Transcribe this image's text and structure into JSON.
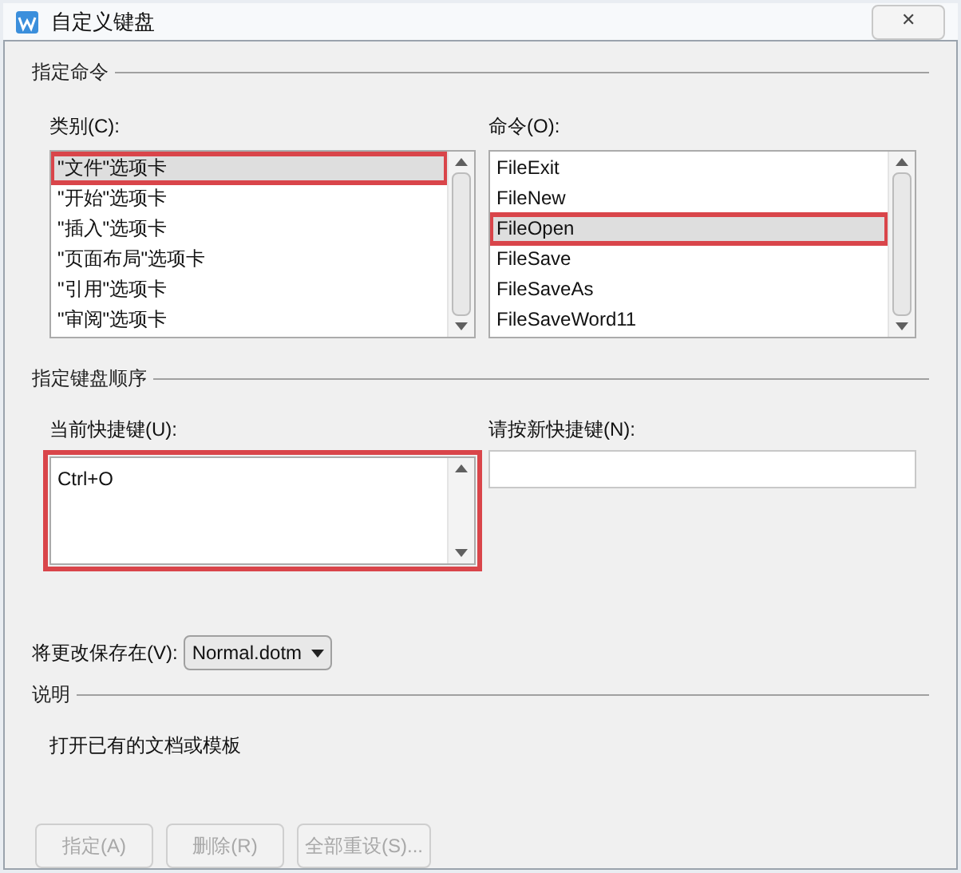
{
  "window": {
    "title": "自定义键盘",
    "close_label": "✕"
  },
  "command_group": {
    "title": "指定命令",
    "category": {
      "label": "类别(C):",
      "items": [
        {
          "text": "\"文件\"选项卡",
          "selected": true,
          "highlighted": true
        },
        {
          "text": "\"开始\"选项卡",
          "selected": false,
          "highlighted": false
        },
        {
          "text": "\"插入\"选项卡",
          "selected": false,
          "highlighted": false
        },
        {
          "text": "\"页面布局\"选项卡",
          "selected": false,
          "highlighted": false
        },
        {
          "text": "\"引用\"选项卡",
          "selected": false,
          "highlighted": false
        },
        {
          "text": "\"审阅\"选项卡",
          "selected": false,
          "highlighted": false
        }
      ]
    },
    "commands": {
      "label": "命令(O):",
      "items": [
        {
          "text": "FileExit",
          "selected": false,
          "highlighted": false
        },
        {
          "text": "FileNew",
          "selected": false,
          "highlighted": false
        },
        {
          "text": "FileOpen",
          "selected": true,
          "highlighted": true
        },
        {
          "text": "FileSave",
          "selected": false,
          "highlighted": false
        },
        {
          "text": "FileSaveAs",
          "selected": false,
          "highlighted": false
        },
        {
          "text": "FileSaveWord11",
          "selected": false,
          "highlighted": false
        }
      ]
    }
  },
  "keyboard_group": {
    "title": "指定键盘顺序",
    "current_keys": {
      "label": "当前快捷键(U):",
      "items": [
        "Ctrl+O"
      ],
      "highlighted": true
    },
    "new_key": {
      "label": "请按新快捷键(N):"
    }
  },
  "save_in": {
    "label": "将更改保存在(V):",
    "value": "Normal.dotm"
  },
  "description": {
    "title": "说明",
    "text": "打开已有的文档或模板"
  },
  "buttons": [
    {
      "label": "指定(A)",
      "disabled": true
    },
    {
      "label": "删除(R)",
      "disabled": true
    },
    {
      "label": "全部重设(S)...",
      "disabled": true
    }
  ]
}
